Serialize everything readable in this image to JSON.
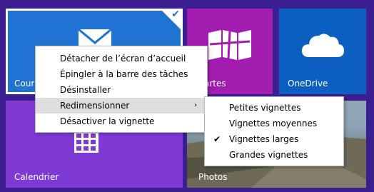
{
  "tiles": {
    "courrier": {
      "label": "Courrier",
      "label_visible": "Cour"
    },
    "cartes": {
      "label": "Cartes",
      "label_visible": "artes"
    },
    "onedrive": {
      "label": "OneDrive"
    },
    "calendrier": {
      "label": "Calendrier"
    },
    "photos": {
      "label": "Photos"
    }
  },
  "context_menu": {
    "items": [
      {
        "label": "Détacher de l’écran d’accueil"
      },
      {
        "label": "Épingler à la barre des tâches"
      },
      {
        "label": "Désinstaller"
      },
      {
        "label": "Redimensionner",
        "has_submenu": true
      },
      {
        "label": "Désactiver la vignette"
      }
    ],
    "submenu_arrow": "›"
  },
  "resize_submenu": {
    "items": [
      {
        "label": "Petites vignettes"
      },
      {
        "label": "Vignettes moyennes"
      },
      {
        "label": "Vignettes larges",
        "checked": true
      },
      {
        "label": "Grandes vignettes"
      }
    ],
    "check_mark": "✔"
  },
  "selected_tile_check": "✔",
  "colors": {
    "background": "#3b1e8f",
    "courrier": "#1f74d3",
    "cartes": "#a21cb0",
    "onedrive": "#0a5fc0",
    "calendrier": "#7f3ad6",
    "menu_highlight": "#dedede"
  }
}
